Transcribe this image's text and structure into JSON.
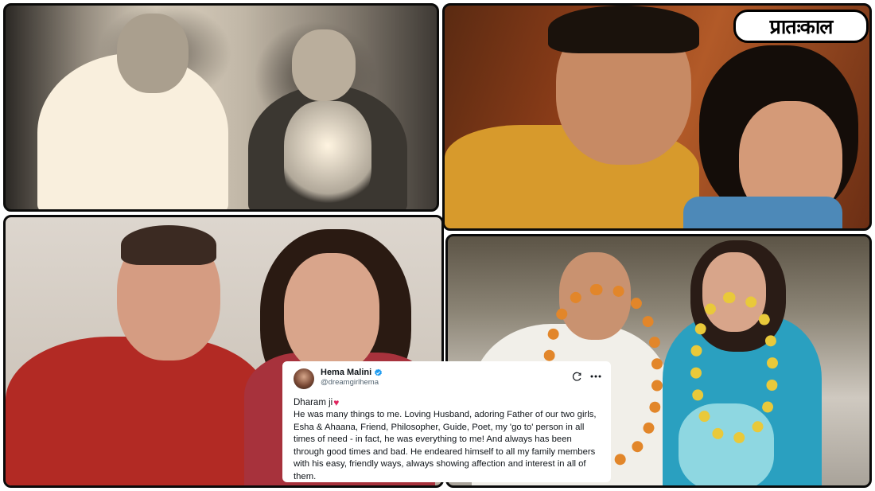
{
  "logo": {
    "text": "प्रातःकाल"
  },
  "photos": [
    {
      "name": "photo-vintage-bw"
    },
    {
      "name": "photo-film-still"
    },
    {
      "name": "photo-recent-red"
    },
    {
      "name": "photo-garlands"
    }
  ],
  "tweet": {
    "author": "Hema Malini",
    "handle": "@dreamgirlhema",
    "greeting": "Dharam ji",
    "body": "He was many things to me. Loving Husband, adoring Father of our two girls, Esha & Ahaana, Friend, Philosopher, Guide, Poet, my 'go to' person in all times of need - in fact, he was everything to me! And always has been through good times and bad. He endeared himself to all my family members with his easy, friendly ways, always showing affection and interest in all of them."
  },
  "colors": {
    "verified": "#1d9bf0",
    "heart": "#e0245e",
    "text": "#0f1419",
    "muted": "#536471"
  }
}
